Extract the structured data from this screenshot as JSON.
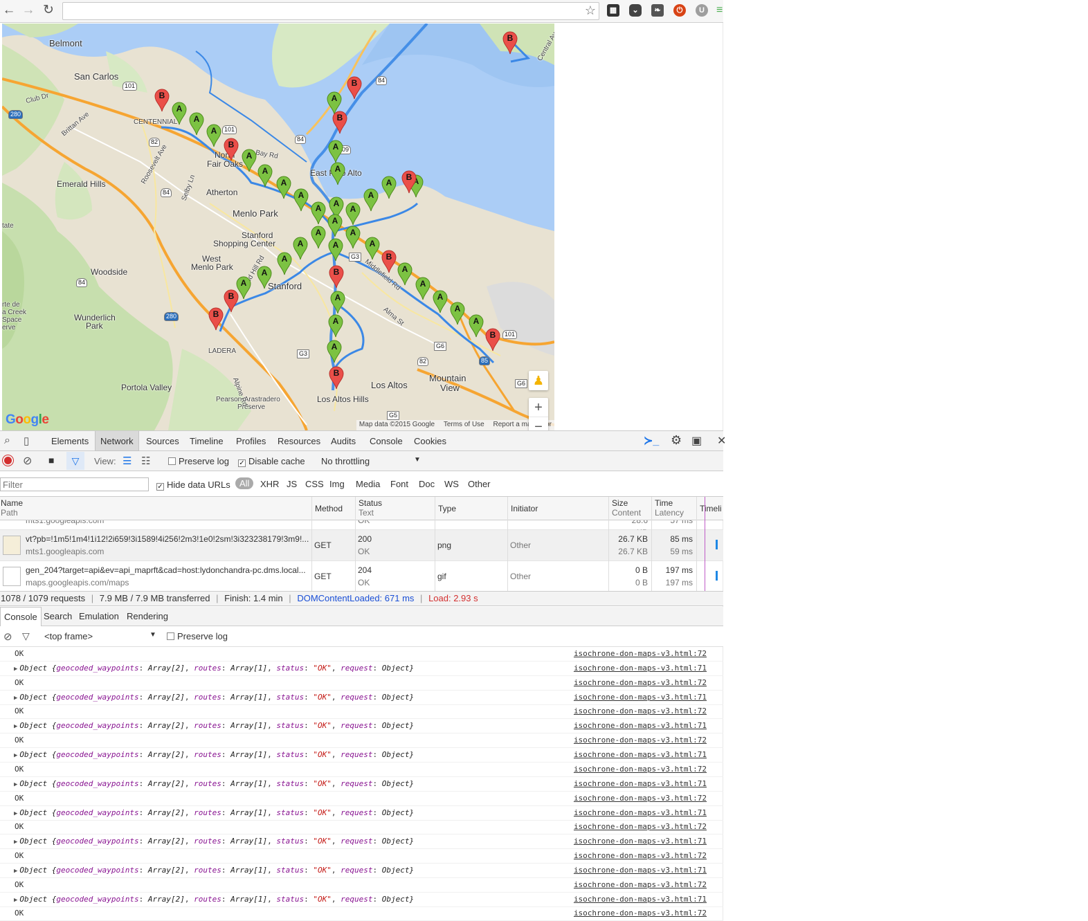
{
  "browser": {
    "omnibox_value": "",
    "extensions": [
      "qr-code-icon",
      "pocket-icon",
      "evernote-icon",
      "power-icon",
      "user-u-icon",
      "menu-icon"
    ]
  },
  "map": {
    "labels": {
      "belmont": "Belmont",
      "san_carlos": "San Carlos",
      "emerald_hills": "Emerald Hills",
      "atherton": "Atherton",
      "menlo_park": "Menlo Park",
      "north_fair_oaks_1": "North",
      "north_fair_oaks_2": "Fair Oaks",
      "east_palo_alto": "East Palo Alto",
      "stanford_shopping_1": "Stanford",
      "stanford_shopping_2": "Shopping Center",
      "west_menlo_1": "West",
      "west_menlo_2": "Menlo Park",
      "woodside": "Woodside",
      "stanford": "Stanford",
      "wunderlich_1": "Wunderlich",
      "wunderlich_2": "Park",
      "portola_valley": "Portola Valley",
      "pearson_1": "Pearson-Arastradero",
      "pearson_2": "Preserve",
      "los_altos": "Los Altos",
      "los_altos_hills": "Los Altos Hills",
      "mountain_view_1": "Mountain",
      "mountain_view_2": "View",
      "ladera": "LADERA",
      "centennial": "CENTENNIAL",
      "alma_st": "Alma St",
      "middlefield_rd": "Middlefield Rd",
      "alpine_rd": "Alpine Rd",
      "sand_hill_rd": "Sand Hill Rd",
      "bay_rd": "Bay Rd",
      "club_dr": "Club Dr",
      "brittan_ave": "Brittan Ave",
      "roosevelt_ave": "Roosevelt Ave",
      "selby_ln": "Selby Ln",
      "tate": "tate",
      "creek_1": "rte de",
      "creek_2": "a Creek",
      "creek_3": "Space",
      "creek_4": "erve",
      "central_ave": "Central Av"
    },
    "shields": [
      "101",
      "101",
      "280",
      "280",
      "82",
      "84",
      "84",
      "84",
      "84",
      "109",
      "G3",
      "G3",
      "G5",
      "G6",
      "G6",
      "85",
      "82",
      "101"
    ],
    "pins_a_label": "A",
    "pins_b_label": "B",
    "logo": "Google",
    "attribution": {
      "data": "Map data ©2015 Google",
      "terms": "Terms of Use",
      "report": "Report a map error"
    },
    "zoom_in": "+",
    "zoom_out": "−"
  },
  "devtools": {
    "tabs": [
      "Elements",
      "Network",
      "Sources",
      "Timeline",
      "Profiles",
      "Resources",
      "Audits",
      "Console",
      "Cookies"
    ],
    "active_tab": "Network",
    "netbar": {
      "view_label": "View:",
      "preserve_log": "Preserve log",
      "disable_cache": "Disable cache",
      "throttling": "No throttling"
    },
    "filter": {
      "placeholder": "Filter",
      "hide_data_urls": "Hide data URLs",
      "types": [
        "All",
        "XHR",
        "JS",
        "CSS",
        "Img",
        "Media",
        "Font",
        "Doc",
        "WS",
        "Other"
      ]
    },
    "columns": {
      "name": "Name",
      "path": "Path",
      "method": "Method",
      "status": "Status",
      "text": "Text",
      "type": "Type",
      "initiator": "Initiator",
      "size": "Size",
      "content": "Content",
      "time": "Time",
      "latency": "Latency",
      "timeline": "Timeli"
    },
    "rows": [
      {
        "name": "",
        "path": "mts1.googleapis.com",
        "method": "",
        "status": "",
        "text": "OK",
        "type": "",
        "initiator": "",
        "size": "",
        "content": "28.6 KB",
        "time": "",
        "latency": "57 ms"
      },
      {
        "name": "vt?pb=!1m5!1m4!1i12!2i659!3i1589!4i256!2m3!1e0!2sm!3i323238179!3m9!...",
        "path": "mts1.googleapis.com",
        "method": "GET",
        "status": "200",
        "text": "OK",
        "type": "png",
        "initiator": "Other",
        "size": "26.7 KB",
        "content": "26.7 KB",
        "time": "85 ms",
        "latency": "59 ms"
      },
      {
        "name": "gen_204?target=api&ev=api_maprft&cad=host:lydonchandra-pc.dms.local...",
        "path": "maps.googleapis.com/maps",
        "method": "GET",
        "status": "204",
        "text": "OK",
        "type": "gif",
        "initiator": "Other",
        "size": "0 B",
        "content": "0 B",
        "time": "197 ms",
        "latency": "197 ms"
      }
    ],
    "summary": {
      "requests": "1078 / 1079 requests",
      "transferred": "7.9 MB / 7.9 MB transferred",
      "finish": "Finish: 1.4 min",
      "dcl": "DOMContentLoaded: 671 ms",
      "load": "Load: 2.93 s"
    },
    "drawer_tabs": [
      "Console",
      "Search",
      "Emulation",
      "Rendering"
    ],
    "console": {
      "context": "<top frame>",
      "preserve_log": "Preserve log",
      "ok_text": "OK",
      "object_parts": {
        "prefix": "Object {",
        "k1": "geocoded_waypoints",
        "v1": "Array[2]",
        "k2": "routes",
        "v2": "Array[1]",
        "k3": "status",
        "v3": "\"OK\"",
        "k4": "request",
        "v4": "Object",
        "suffix": "}"
      },
      "src_72": "isochrone-don-maps-v3.html:72",
      "src_71": "isochrone-don-maps-v3.html:71"
    }
  }
}
